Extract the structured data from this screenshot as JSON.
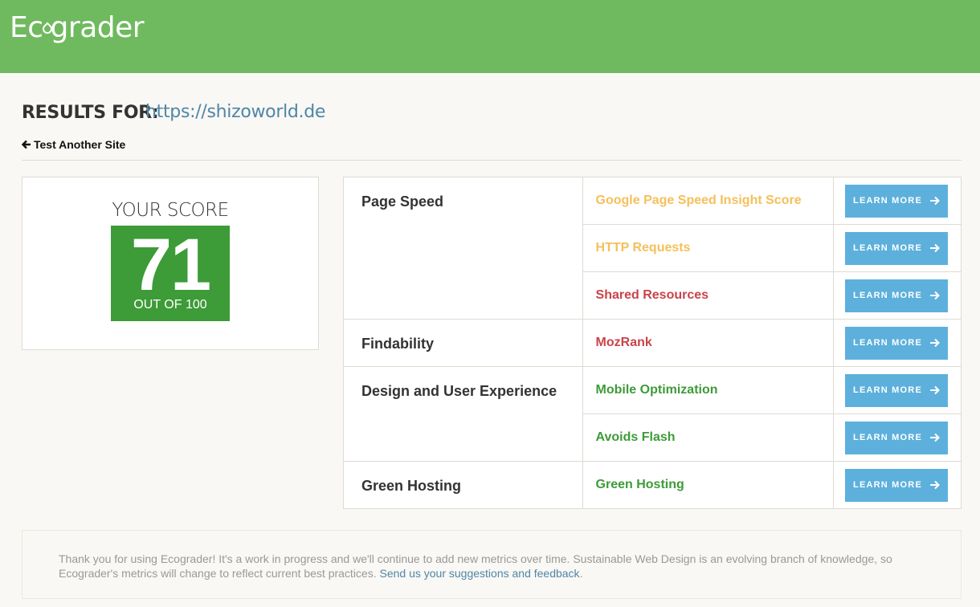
{
  "header": {
    "logo_text_1": "Ec",
    "logo_text_2": "grader"
  },
  "results": {
    "label": "RESULTS FOR:",
    "url": "https://shizoworld.de",
    "back_label": "Test Another Site"
  },
  "score": {
    "label": "YOUR SCORE",
    "value": "71",
    "out_of": "OUT OF 100"
  },
  "learn_more_label": "LEARN MORE",
  "categories": [
    {
      "name": "Page Speed",
      "metrics": [
        {
          "name": "Google Page Speed Insight Score",
          "status": "warning"
        },
        {
          "name": "HTTP Requests",
          "status": "warning"
        },
        {
          "name": "Shared Resources",
          "status": "fail"
        }
      ]
    },
    {
      "name": "Findability",
      "metrics": [
        {
          "name": "MozRank",
          "status": "fail"
        }
      ]
    },
    {
      "name": "Design and User Experience",
      "metrics": [
        {
          "name": "Mobile Optimization",
          "status": "pass"
        },
        {
          "name": "Avoids Flash",
          "status": "pass"
        }
      ]
    },
    {
      "name": "Green Hosting",
      "metrics": [
        {
          "name": "Green Hosting",
          "status": "pass"
        }
      ]
    }
  ],
  "colors": {
    "header": "#6fba5e",
    "score_tile": "#3d9b38",
    "warning": "#f5c05a",
    "fail": "#c9434a",
    "pass": "#3d9b38",
    "button": "#5db0dc"
  },
  "footer": {
    "text": "Thank you for using Ecograder! It's a work in progress and we'll continue to add new metrics over time. Sustainable Web Design is an evolving branch of knowledge, so Ecograder's metrics will change to reflect current best practices.",
    "link_label": "Send us your suggestions and feedback",
    "end": "."
  }
}
